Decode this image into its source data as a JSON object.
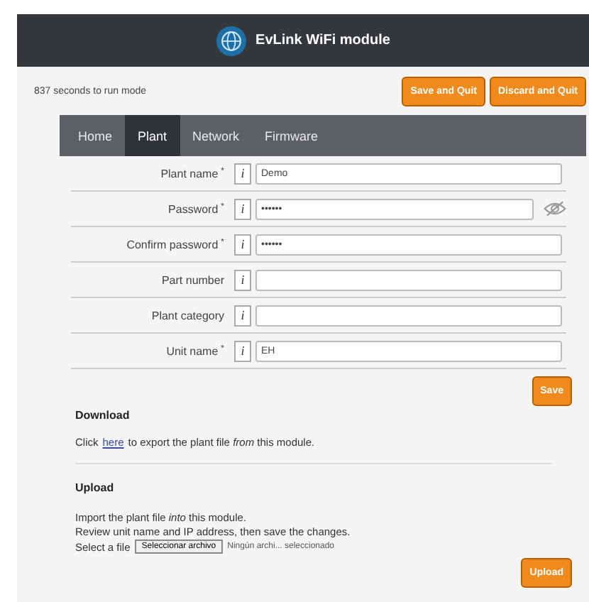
{
  "header": {
    "title": "EvLink WiFi module"
  },
  "timer": "837 seconds to run mode",
  "top_buttons": [
    "Save and Quit",
    "Discard and Quit"
  ],
  "tabs": [
    {
      "label": "Home",
      "selected": false
    },
    {
      "label": "Plant",
      "selected": true
    },
    {
      "label": "Network",
      "selected": false
    },
    {
      "label": "Firmware",
      "selected": false
    }
  ],
  "fields": [
    {
      "label": "Plant name",
      "required_mark": "*",
      "info": "i",
      "kind": "text",
      "value": "Demo"
    },
    {
      "label": "Password",
      "required_mark": "*",
      "info": "i",
      "kind": "password",
      "value": "••••••"
    },
    {
      "label": "Confirm password",
      "required_mark": "*",
      "info": "i",
      "kind": "text",
      "value": "••••••"
    },
    {
      "label": "Part number",
      "info": "i",
      "kind": "text"
    },
    {
      "label": "Plant category",
      "info": "i",
      "kind": "text"
    },
    {
      "label": "Unit name",
      "required_mark": "*",
      "info": "i",
      "kind": "text",
      "value": "EH"
    }
  ],
  "save_button": "Save",
  "download": {
    "heading": "Download",
    "prefix": "Click",
    "link": "here",
    "text": "to export the plant file *from* this module."
  },
  "upload": {
    "heading": "Upload",
    "lines": [
      "Import the plant file *into* this module.",
      "Review unit name and IP address, then save the changes."
    ],
    "select_label": "Select a file",
    "file_button": "Seleccionar archivo",
    "file_status": "Ningún archi... seleccionado",
    "button": "Upload"
  }
}
